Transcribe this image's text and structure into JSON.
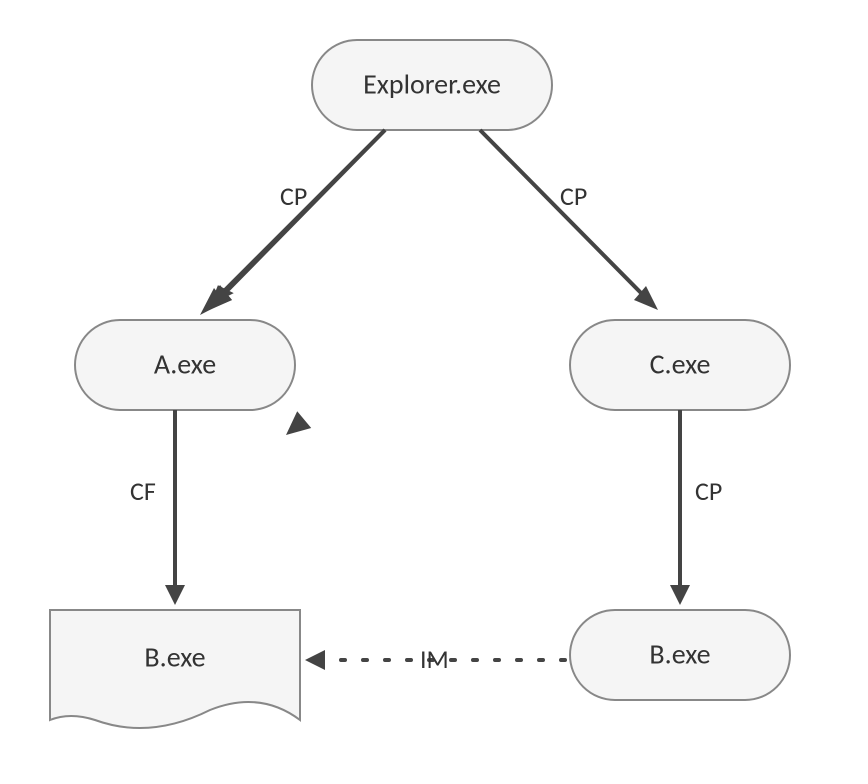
{
  "diagram": {
    "nodes": {
      "root": "Explorer.exe",
      "left_child": "A.exe",
      "right_child": "C.exe",
      "left_grandchild": "B.exe",
      "right_grandchild": "B.exe"
    },
    "edges": {
      "root_to_left": "CP",
      "root_to_right": "CP",
      "left_to_grandchild": "CF",
      "right_to_grandchild": "CP",
      "cross_link": "IM"
    }
  }
}
